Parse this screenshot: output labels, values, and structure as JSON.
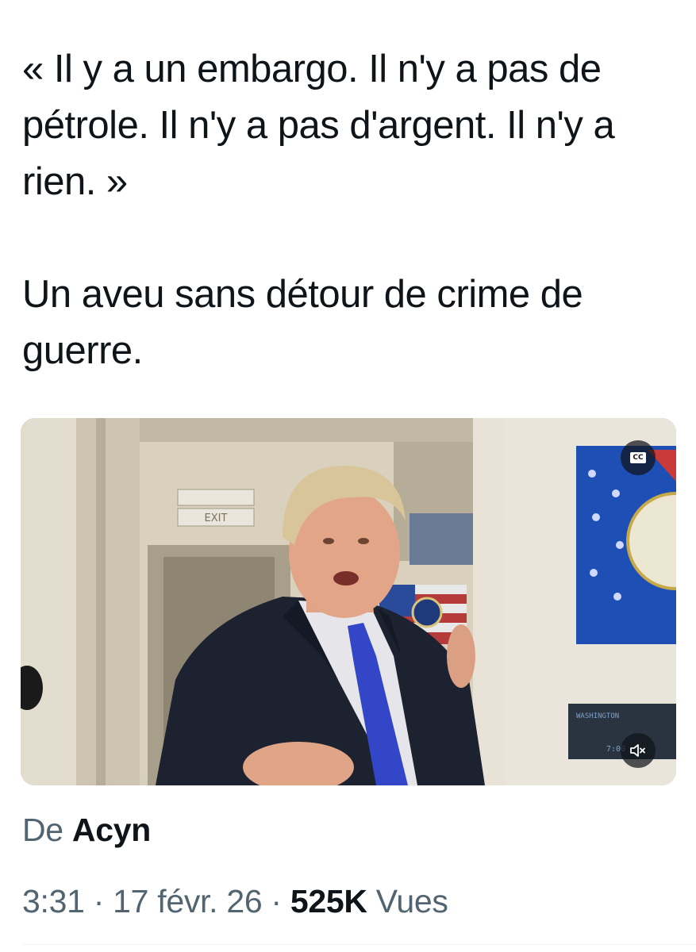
{
  "tweet": {
    "text_lines": [
      "« Il y a un embargo. Il n'y a pas de pétrole. Il n'y a pas d'argent. Il n'y a rien. »",
      "Un aveu sans détour de crime de guerre."
    ]
  },
  "media": {
    "type": "video",
    "controls": {
      "captions_label": "CC",
      "captions_icon": "closed-captions-icon",
      "mute_icon": "speaker-muted-icon"
    },
    "scene_text": {
      "exit_sign": "EXIT",
      "panel_label": "WASHINGTON",
      "panel_time": "7:00"
    }
  },
  "source": {
    "prefix": "De",
    "author": "Acyn"
  },
  "meta": {
    "time": "3:31",
    "separator": "·",
    "date": "17 févr. 26",
    "views_count": "525K",
    "views_label": "Vues"
  },
  "colors": {
    "text_primary": "#0f1419",
    "text_secondary": "#536471",
    "divider": "#eff3f4"
  }
}
